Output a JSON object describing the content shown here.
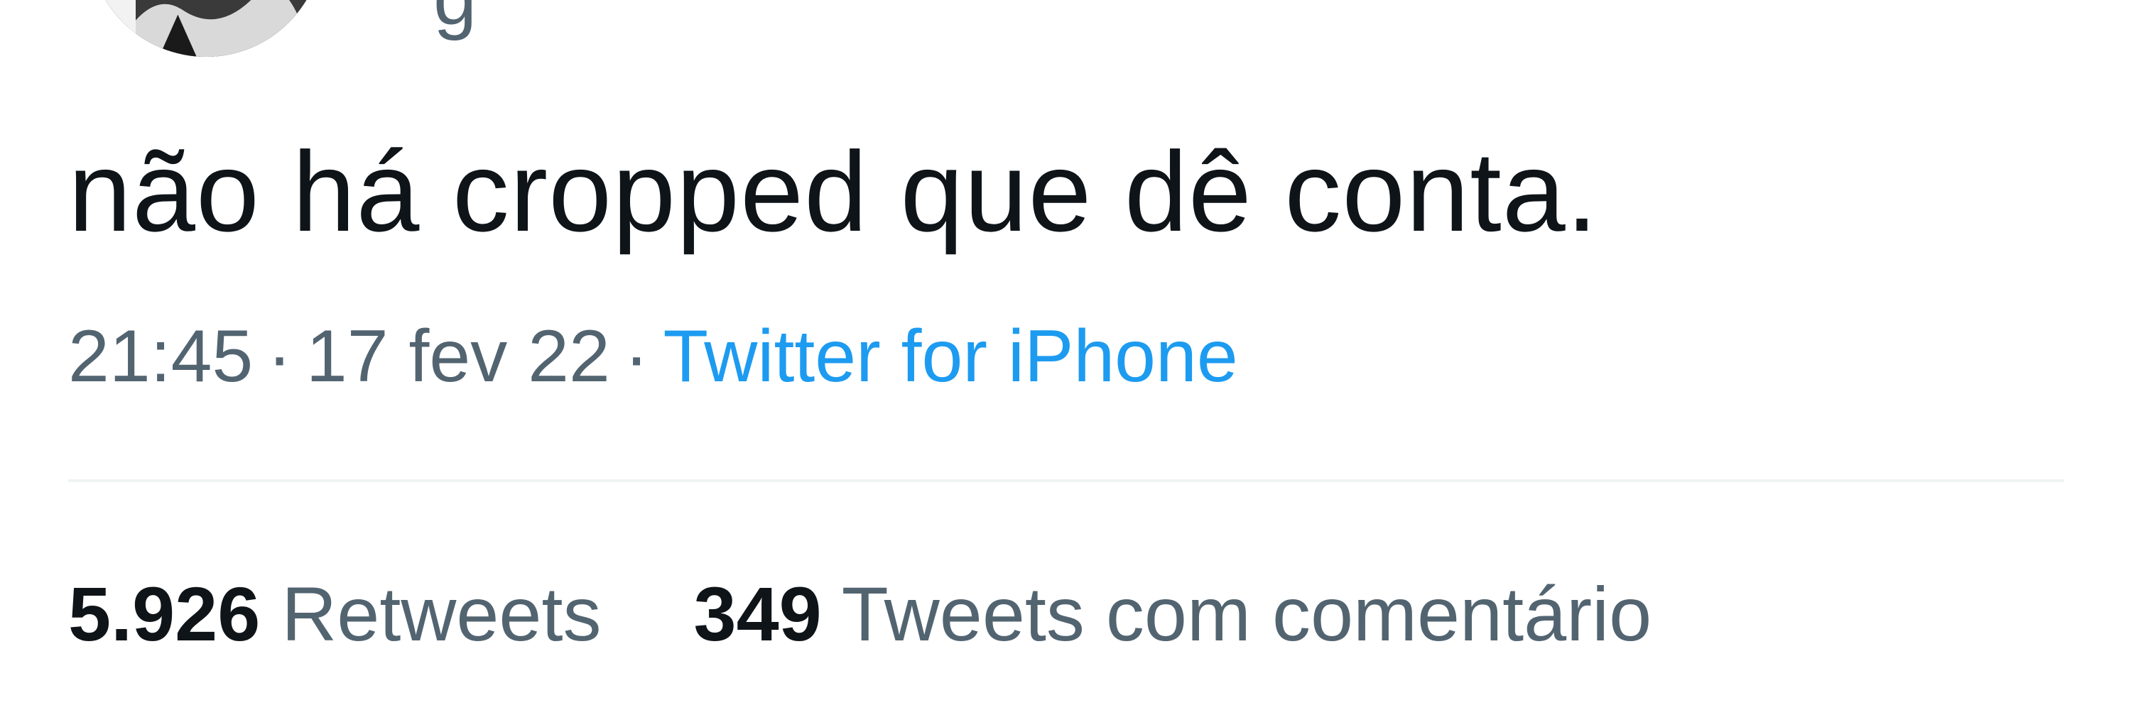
{
  "tweet": {
    "handle_fragment": "g",
    "text": "não há cropped que dê conta.",
    "time": "21:45",
    "date": "17 fev 22",
    "separator": "·",
    "source": "Twitter for iPhone"
  },
  "stats": {
    "retweets_count": "5.926",
    "retweets_label": "Retweets",
    "quotes_count": "349",
    "quotes_label": "Tweets com comentário"
  },
  "colors": {
    "text": "#0f1419",
    "secondary": "#536471",
    "link": "#1d9bf0",
    "divider": "#eff3f4"
  }
}
